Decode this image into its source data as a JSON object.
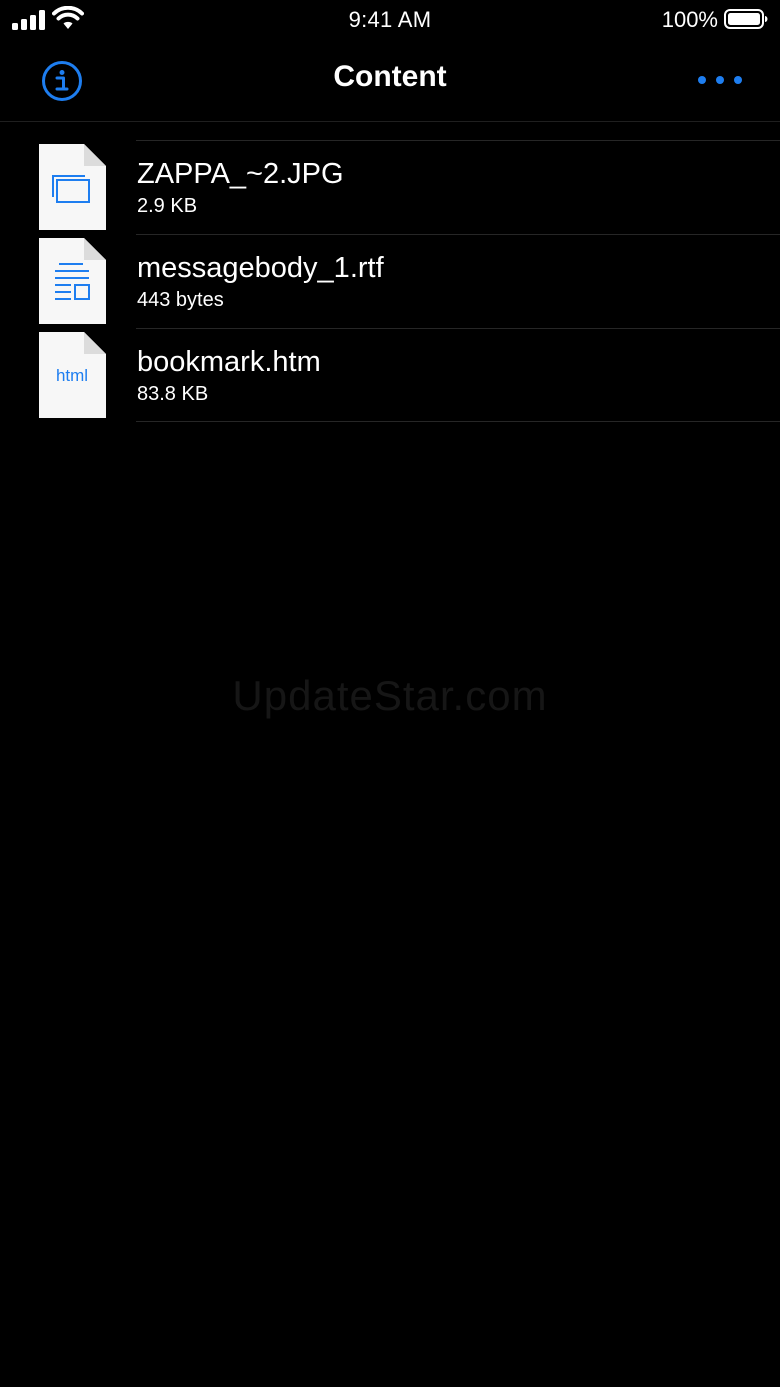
{
  "status_bar": {
    "time": "9:41 AM",
    "battery_percent": "100%",
    "signal_icon": "cellular-signal-icon",
    "wifi_icon": "wifi-icon",
    "battery_icon": "battery-full-icon"
  },
  "nav_bar": {
    "title": "Content",
    "left_icon": "info-icon",
    "right_icon": "more-dots-icon"
  },
  "files": [
    {
      "name": "ZAPPA_~2.JPG",
      "size": "2.9 KB",
      "icon": "image-file-icon"
    },
    {
      "name": "messagebody_1.rtf",
      "size": "443 bytes",
      "icon": "document-file-icon"
    },
    {
      "name": "bookmark.htm",
      "size": "83.8 KB",
      "icon": "html-file-icon",
      "icon_label": "html"
    }
  ],
  "watermark": "UpdateStar.com",
  "colors": {
    "accent": "#1e7ef0",
    "background": "#000000",
    "separator": "#262626",
    "file_icon_bg": "#f7f7f7"
  }
}
